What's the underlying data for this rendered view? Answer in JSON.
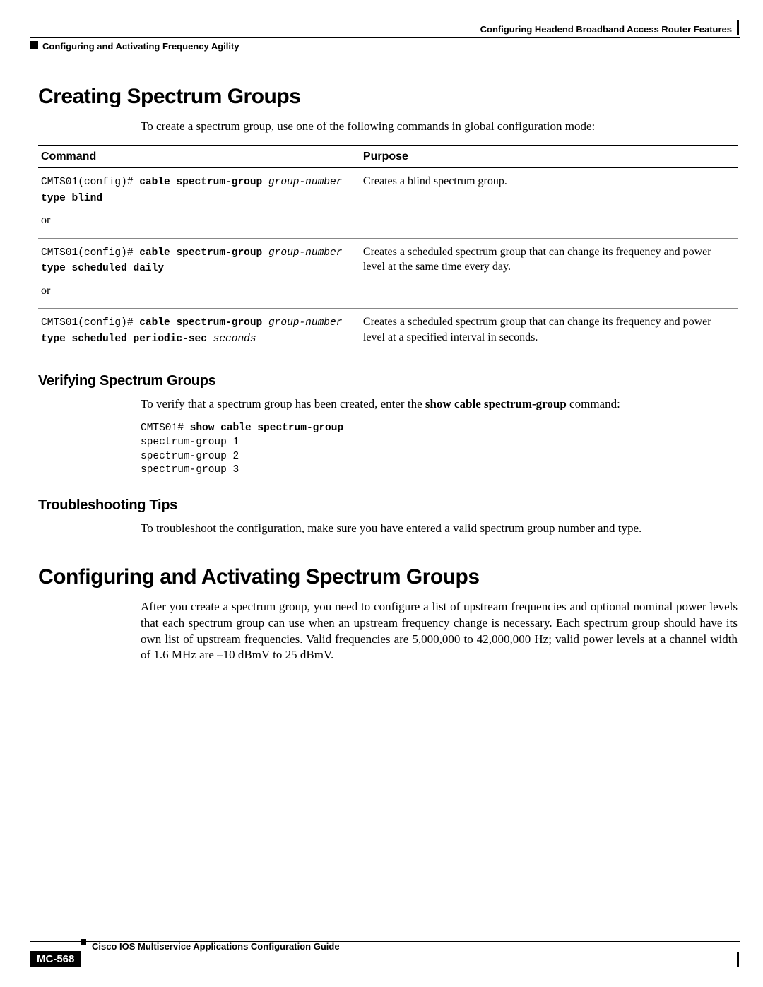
{
  "header": {
    "right": "Configuring Headend Broadband Access Router Features",
    "left": "Configuring and Activating Frequency Agility"
  },
  "section1": {
    "title": "Creating Spectrum Groups",
    "intro": "To create a spectrum group, use one of the following commands in global configuration mode:"
  },
  "table": {
    "th_command": "Command",
    "th_purpose": "Purpose",
    "rows": [
      {
        "prompt": "CMTS01(config)# ",
        "cmd1": "cable spectrum-group",
        "arg1": " group-number ",
        "cmd2": "type blind",
        "or": "or",
        "purpose": "Creates a blind spectrum group."
      },
      {
        "prompt": "CMTS01(config)# ",
        "cmd1": "cable spectrum-group",
        "arg1": " group-number ",
        "cmd2": "type scheduled daily",
        "or": "or",
        "purpose": "Creates a scheduled spectrum group that can change its frequency and power level at the same time every day."
      },
      {
        "prompt": "CMTS01(config)# ",
        "cmd1": "cable spectrum-group",
        "arg1": " group-number ",
        "cmd2": "type scheduled periodic-sec",
        "arg2": " seconds",
        "purpose": "Creates a scheduled spectrum group that can change its frequency and power level at a specified interval in seconds."
      }
    ]
  },
  "section2": {
    "title": "Verifying Spectrum Groups",
    "intro_pre": "To verify that a spectrum group has been created, enter the ",
    "intro_bold": "show cable spectrum-group",
    "intro_post": " command:",
    "code_prompt": "CMTS01# ",
    "code_bold": "show cable spectrum-group",
    "code_lines": "spectrum-group 1\nspectrum-group 2\nspectrum-group 3"
  },
  "section3": {
    "title": "Troubleshooting Tips",
    "para": "To troubleshoot the configuration, make sure you have entered a valid spectrum group number and type."
  },
  "section4": {
    "title": "Configuring and Activating Spectrum Groups",
    "para": "After you create a spectrum group, you need to configure a list of upstream frequencies and optional nominal power levels that each spectrum group can use when an upstream frequency change is necessary. Each spectrum group should have its own list of upstream frequencies. Valid frequencies are 5,000,000 to 42,000,000 Hz; valid power levels at a channel width of 1.6 MHz are –10 dBmV to 25 dBmV."
  },
  "footer": {
    "guide": "Cisco IOS Multiservice Applications Configuration Guide",
    "pagenum": "MC-568"
  }
}
